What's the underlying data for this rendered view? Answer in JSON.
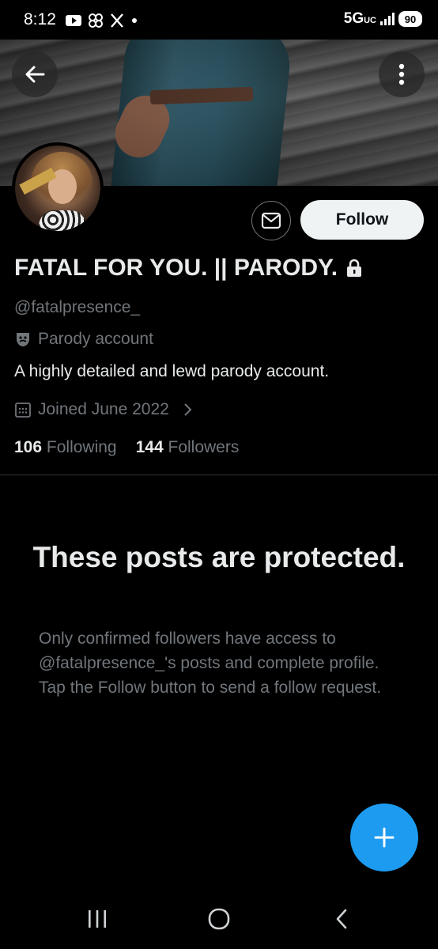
{
  "status_bar": {
    "time": "8:12",
    "network": "5G",
    "network_sub": "UC",
    "battery": "90",
    "icons": [
      "youtube-icon",
      "pinwheel-icon",
      "x-icon",
      "dot-icon",
      "signal-icon"
    ]
  },
  "header": {
    "back_icon": "arrow-left-icon",
    "more_icon": "more-vertical-icon"
  },
  "profile": {
    "display_name": "FATAL FOR YOU. || PARODY.",
    "protected_icon": "lock-icon",
    "handle": "@fatalpresence_",
    "parody_label": "Parody account",
    "bio": "A highly detailed and lewd parody account.",
    "joined": "Joined June 2022",
    "following_count": "106",
    "following_label": "Following",
    "followers_count": "144",
    "followers_label": "Followers"
  },
  "actions": {
    "message_icon": "envelope-icon",
    "follow_label": "Follow"
  },
  "protected_notice": {
    "title": "These posts are protected.",
    "description": "Only confirmed followers have access to @fatalpresence_'s posts and complete profile. Tap the Follow button to send a follow request."
  },
  "colors": {
    "accent": "#1d9bf0",
    "background": "#000000",
    "secondary_text": "#71767b"
  },
  "nav_bar": {
    "recents_icon": "recents-icon",
    "home_icon": "home-icon",
    "back_icon": "back-icon"
  }
}
